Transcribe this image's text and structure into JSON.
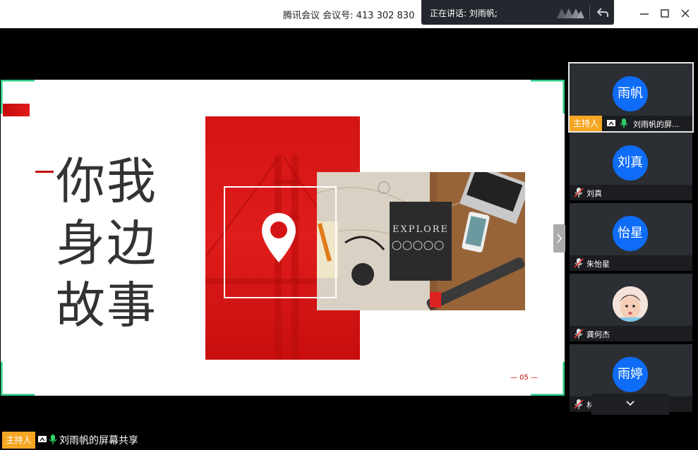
{
  "titlebar": {
    "meeting_info": "腾讯会议  会议号: 413 302 830",
    "speaking": "正在讲话: 刘雨帆;"
  },
  "slide": {
    "title_lines": [
      "你我",
      "身边",
      "故事"
    ],
    "page_number": "— 05 —",
    "book_title": "EXPLORE"
  },
  "bottom": {
    "host_badge": "主持人",
    "share_label": "刘雨帆的屏幕共享"
  },
  "participants": [
    {
      "avatar": "雨帆",
      "name": "刘雨帆的屏...",
      "host": "主持人",
      "selected": true
    },
    {
      "avatar": "刘真",
      "name": "刘真"
    },
    {
      "avatar": "怡星",
      "name": "朱怡星"
    },
    {
      "avatar": "",
      "name": "龚何杰",
      "photo": true
    },
    {
      "avatar": "雨婷",
      "name": "林雨婷"
    }
  ],
  "colors": {
    "accent_red": "#d41414",
    "avatar_blue": "#0e6cf7",
    "host_orange": "#f5a623",
    "frame_green": "#2ecc87"
  },
  "icons": [
    "minimize-icon",
    "maximize-icon",
    "close-icon",
    "undo-icon",
    "share-screen-icon",
    "mic-icon",
    "mic-muted-icon",
    "chevron-right-icon",
    "chevron-down-icon",
    "location-pin-icon"
  ]
}
